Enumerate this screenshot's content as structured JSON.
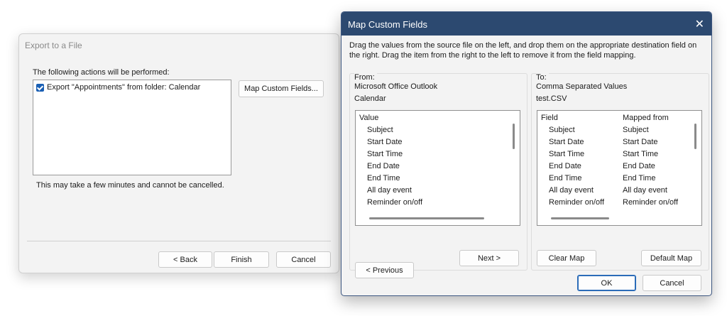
{
  "export_dialog": {
    "title": "Export to a File",
    "actions_label": "The following actions will be performed:",
    "action_item": "Export \"Appointments\" from folder: Calendar",
    "map_button": "Map Custom Fields...",
    "note": "This may take a few minutes and cannot be cancelled.",
    "back": "< Back",
    "finish": "Finish",
    "cancel": "Cancel"
  },
  "map_dialog": {
    "title": "Map Custom Fields",
    "close": "✕",
    "instructions": "Drag the values from the source file on the left, and drop them on the appropriate destination field on the right.  Drag the item from the right to the left to remove it from the field mapping.",
    "from": {
      "label": "From:",
      "line1": "Microsoft Office Outlook",
      "line2": "Calendar",
      "header": "Value",
      "items": [
        "Subject",
        "Start Date",
        "Start Time",
        "End Date",
        "End Time",
        "All day event",
        "Reminder on/off"
      ],
      "previous": "< Previous",
      "next": "Next >"
    },
    "to": {
      "label": "To:",
      "line1": "Comma Separated Values",
      "line2": "test.CSV",
      "header_field": "Field",
      "header_mapped": "Mapped from",
      "rows": [
        [
          "Subject",
          "Subject"
        ],
        [
          "Start Date",
          "Start Date"
        ],
        [
          "Start Time",
          "Start Time"
        ],
        [
          "End Date",
          "End Date"
        ],
        [
          "End Time",
          "End Time"
        ],
        [
          "All day event",
          "All day event"
        ],
        [
          "Reminder on/off",
          "Reminder on/off"
        ]
      ],
      "clear_map": "Clear Map",
      "default_map": "Default Map"
    },
    "ok": "OK",
    "cancel": "Cancel"
  }
}
